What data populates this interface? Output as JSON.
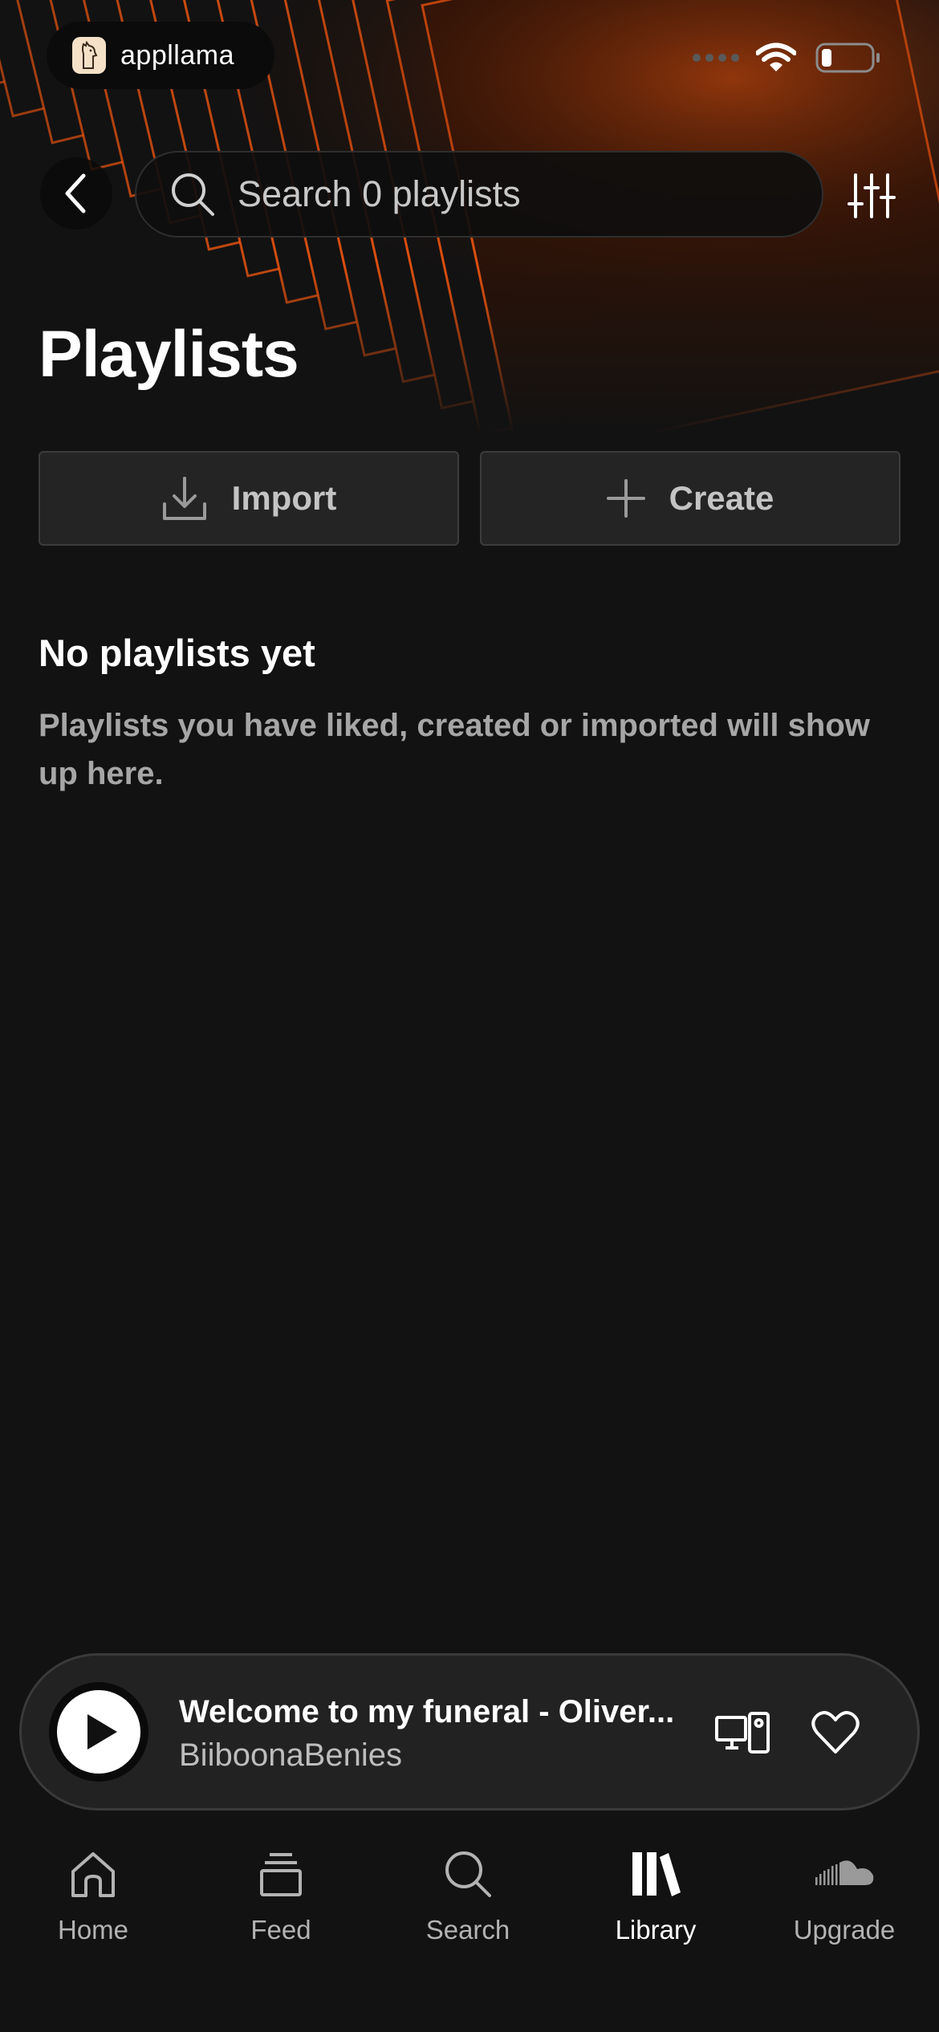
{
  "status_bar": {
    "brand": "appllama"
  },
  "header": {
    "search_placeholder": "Search 0 playlists"
  },
  "page": {
    "title": "Playlists"
  },
  "actions": {
    "import_label": "Import",
    "create_label": "Create"
  },
  "empty_state": {
    "title": "No playlists yet",
    "description": "Playlists you have liked, created or imported will show up here."
  },
  "mini_player": {
    "track_title": "Welcome to my funeral - Oliver...",
    "artist": "BiiboonaBenies"
  },
  "nav": {
    "items": [
      {
        "label": "Home",
        "icon": "home-icon",
        "active": false
      },
      {
        "label": "Feed",
        "icon": "feed-icon",
        "active": false
      },
      {
        "label": "Search",
        "icon": "search-icon",
        "active": false
      },
      {
        "label": "Library",
        "icon": "library-icon",
        "active": true
      },
      {
        "label": "Upgrade",
        "icon": "soundcloud-icon",
        "active": false
      }
    ]
  },
  "colors": {
    "background": "#121212",
    "accent_orange": "#ff5a10",
    "button_bg": "#242424",
    "secondary_text": "#a6a6a6"
  }
}
